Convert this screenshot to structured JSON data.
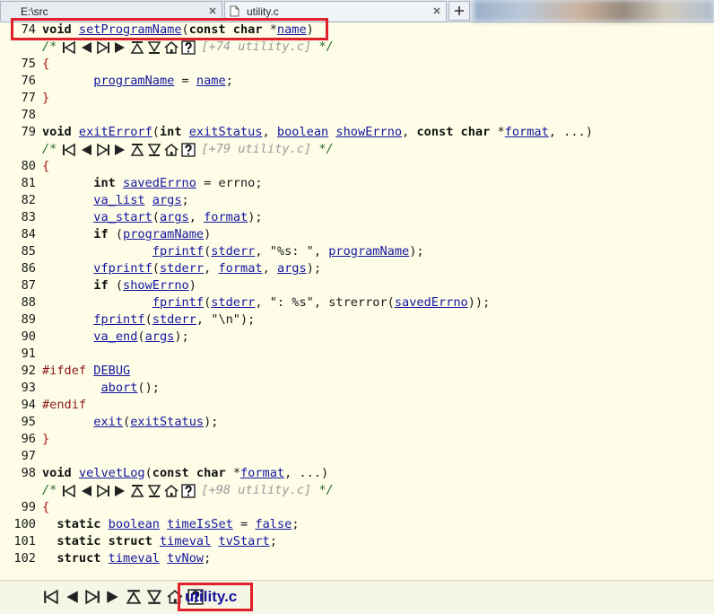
{
  "tabs": [
    {
      "label": "E:\\src",
      "active": false
    },
    {
      "label": "utility.c",
      "active": true
    }
  ],
  "new_tab_label": "+",
  "colors": {
    "highlight": "#e0202a",
    "identifier": "#1616a0",
    "brace": "#b01010",
    "comment": "#2b6b2b",
    "background": "#fdfde8"
  },
  "icons": [
    "nav-first-icon",
    "nav-prev-icon",
    "nav-last-icon",
    "nav-next-icon",
    "nav-up-icon",
    "nav-down-icon",
    "home-icon",
    "help-icon"
  ],
  "code": {
    "nav_comment_open": "/*",
    "nav_comment_close": "*/",
    "nav_refs": [
      "[+74 utility.c]",
      "[+79 utility.c]",
      "[+98 utility.c]"
    ],
    "lines": [
      {
        "n": "74",
        "k": "sig1"
      },
      {
        "nav": 0
      },
      {
        "n": "75",
        "k": "brace",
        "t": "{"
      },
      {
        "n": "76",
        "k": "l76"
      },
      {
        "n": "77",
        "k": "brace",
        "t": "}"
      },
      {
        "n": "78",
        "k": "blank"
      },
      {
        "n": "79",
        "k": "sig2"
      },
      {
        "nav": 1
      },
      {
        "n": "80",
        "k": "brace",
        "t": "{"
      },
      {
        "n": "81",
        "k": "l81"
      },
      {
        "n": "82",
        "k": "l82"
      },
      {
        "n": "83",
        "k": "l83"
      },
      {
        "n": "84",
        "k": "l84"
      },
      {
        "n": "85",
        "k": "l85"
      },
      {
        "n": "86",
        "k": "l86"
      },
      {
        "n": "87",
        "k": "l87"
      },
      {
        "n": "88",
        "k": "l88"
      },
      {
        "n": "89",
        "k": "l89"
      },
      {
        "n": "90",
        "k": "l90"
      },
      {
        "n": "91",
        "k": "blank"
      },
      {
        "n": "92",
        "k": "l92"
      },
      {
        "n": "93",
        "k": "l93"
      },
      {
        "n": "94",
        "k": "l94"
      },
      {
        "n": "95",
        "k": "l95"
      },
      {
        "n": "96",
        "k": "brace",
        "t": "}"
      },
      {
        "n": "97",
        "k": "blank"
      },
      {
        "n": "98",
        "k": "sig3"
      },
      {
        "nav": 2
      },
      {
        "n": "99",
        "k": "brace",
        "t": "{"
      },
      {
        "n": "100",
        "k": "l100"
      },
      {
        "n": "101",
        "k": "l101"
      },
      {
        "n": "102",
        "k": "l102"
      }
    ],
    "tokens": {
      "sig1": [
        [
          "kw",
          "void "
        ],
        [
          "id",
          "setProgramName"
        ],
        [
          "",
          "("
        ],
        [
          "kw",
          "const char "
        ],
        [
          "",
          "*"
        ],
        [
          "id",
          "name"
        ],
        [
          "",
          ")"
        ]
      ],
      "l76": [
        [
          "",
          "       "
        ],
        [
          "id",
          "programName"
        ],
        [
          "",
          " = "
        ],
        [
          "id",
          "name"
        ],
        [
          "",
          ";"
        ]
      ],
      "sig2": [
        [
          "kw",
          "void "
        ],
        [
          "id",
          "exitErrorf"
        ],
        [
          "",
          "("
        ],
        [
          "kw",
          "int "
        ],
        [
          "id",
          "exitStatus"
        ],
        [
          "",
          ", "
        ],
        [
          "id",
          "boolean"
        ],
        [
          "",
          " "
        ],
        [
          "id",
          "showErrno"
        ],
        [
          "",
          ", "
        ],
        [
          "kw",
          "const char "
        ],
        [
          "",
          "*"
        ],
        [
          "id",
          "format"
        ],
        [
          "",
          ", ...)"
        ]
      ],
      "l81": [
        [
          "",
          "       "
        ],
        [
          "kw",
          "int "
        ],
        [
          "id",
          "savedErrno"
        ],
        [
          "",
          " = errno;"
        ]
      ],
      "l82": [
        [
          "",
          "       "
        ],
        [
          "id",
          "va_list"
        ],
        [
          "",
          " "
        ],
        [
          "id",
          "args"
        ],
        [
          "",
          ";"
        ]
      ],
      "l83": [
        [
          "",
          "       "
        ],
        [
          "id",
          "va_start"
        ],
        [
          "",
          "("
        ],
        [
          "id",
          "args"
        ],
        [
          "",
          ", "
        ],
        [
          "id",
          "format"
        ],
        [
          "",
          ");"
        ]
      ],
      "l84": [
        [
          "",
          "       "
        ],
        [
          "kw",
          "if "
        ],
        [
          "",
          "("
        ],
        [
          "id",
          "programName"
        ],
        [
          "",
          ")"
        ]
      ],
      "l85": [
        [
          "",
          "               "
        ],
        [
          "id",
          "fprintf"
        ],
        [
          "",
          "("
        ],
        [
          "id",
          "stderr"
        ],
        [
          "",
          ", \"%s: \", "
        ],
        [
          "id",
          "programName"
        ],
        [
          "",
          ");"
        ]
      ],
      "l86": [
        [
          "",
          "       "
        ],
        [
          "id",
          "vfprintf"
        ],
        [
          "",
          "("
        ],
        [
          "id",
          "stderr"
        ],
        [
          "",
          ", "
        ],
        [
          "id",
          "format"
        ],
        [
          "",
          ", "
        ],
        [
          "id",
          "args"
        ],
        [
          "",
          ");"
        ]
      ],
      "l87": [
        [
          "",
          "       "
        ],
        [
          "kw",
          "if "
        ],
        [
          "",
          "("
        ],
        [
          "id",
          "showErrno"
        ],
        [
          "",
          ")"
        ]
      ],
      "l88": [
        [
          "",
          "               "
        ],
        [
          "id",
          "fprintf"
        ],
        [
          "",
          "("
        ],
        [
          "id",
          "stderr"
        ],
        [
          "",
          ", \": %s\", strerror("
        ],
        [
          "id",
          "savedErrno"
        ],
        [
          "",
          "));"
        ]
      ],
      "l89": [
        [
          "",
          "       "
        ],
        [
          "id",
          "fprintf"
        ],
        [
          "",
          "("
        ],
        [
          "id",
          "stderr"
        ],
        [
          "",
          ", \"\\n\");"
        ]
      ],
      "l90": [
        [
          "",
          "       "
        ],
        [
          "id",
          "va_end"
        ],
        [
          "",
          "("
        ],
        [
          "id",
          "args"
        ],
        [
          "",
          ");"
        ]
      ],
      "l92": [
        [
          "pp",
          "#ifdef "
        ],
        [
          "id",
          "DEBUG"
        ]
      ],
      "l93": [
        [
          "",
          "        "
        ],
        [
          "id",
          "abort"
        ],
        [
          "",
          "();"
        ]
      ],
      "l94": [
        [
          "pp",
          "#endif"
        ]
      ],
      "l95": [
        [
          "",
          "       "
        ],
        [
          "id",
          "exit"
        ],
        [
          "",
          "("
        ],
        [
          "id",
          "exitStatus"
        ],
        [
          "",
          ");"
        ]
      ],
      "sig3": [
        [
          "kw",
          "void "
        ],
        [
          "id",
          "velvetLog"
        ],
        [
          "",
          "("
        ],
        [
          "kw",
          "const char "
        ],
        [
          "",
          "*"
        ],
        [
          "id",
          "format"
        ],
        [
          "",
          ", ...)"
        ]
      ],
      "l100": [
        [
          "",
          "  "
        ],
        [
          "kw",
          "static "
        ],
        [
          "id",
          "boolean"
        ],
        [
          "",
          " "
        ],
        [
          "id",
          "timeIsSet"
        ],
        [
          "",
          " = "
        ],
        [
          "id",
          "false"
        ],
        [
          "",
          ";"
        ]
      ],
      "l101": [
        [
          "",
          "  "
        ],
        [
          "kw",
          "static struct "
        ],
        [
          "id",
          "timeval"
        ],
        [
          "",
          " "
        ],
        [
          "id",
          "tvStart"
        ],
        [
          "",
          ";"
        ]
      ],
      "l102": [
        [
          "",
          "  "
        ],
        [
          "kw",
          "struct "
        ],
        [
          "id",
          "timeval"
        ],
        [
          "",
          " "
        ],
        [
          "id",
          "tvNow"
        ],
        [
          "",
          ";"
        ]
      ]
    }
  },
  "bottom_bar": {
    "filename": "utility.c"
  }
}
